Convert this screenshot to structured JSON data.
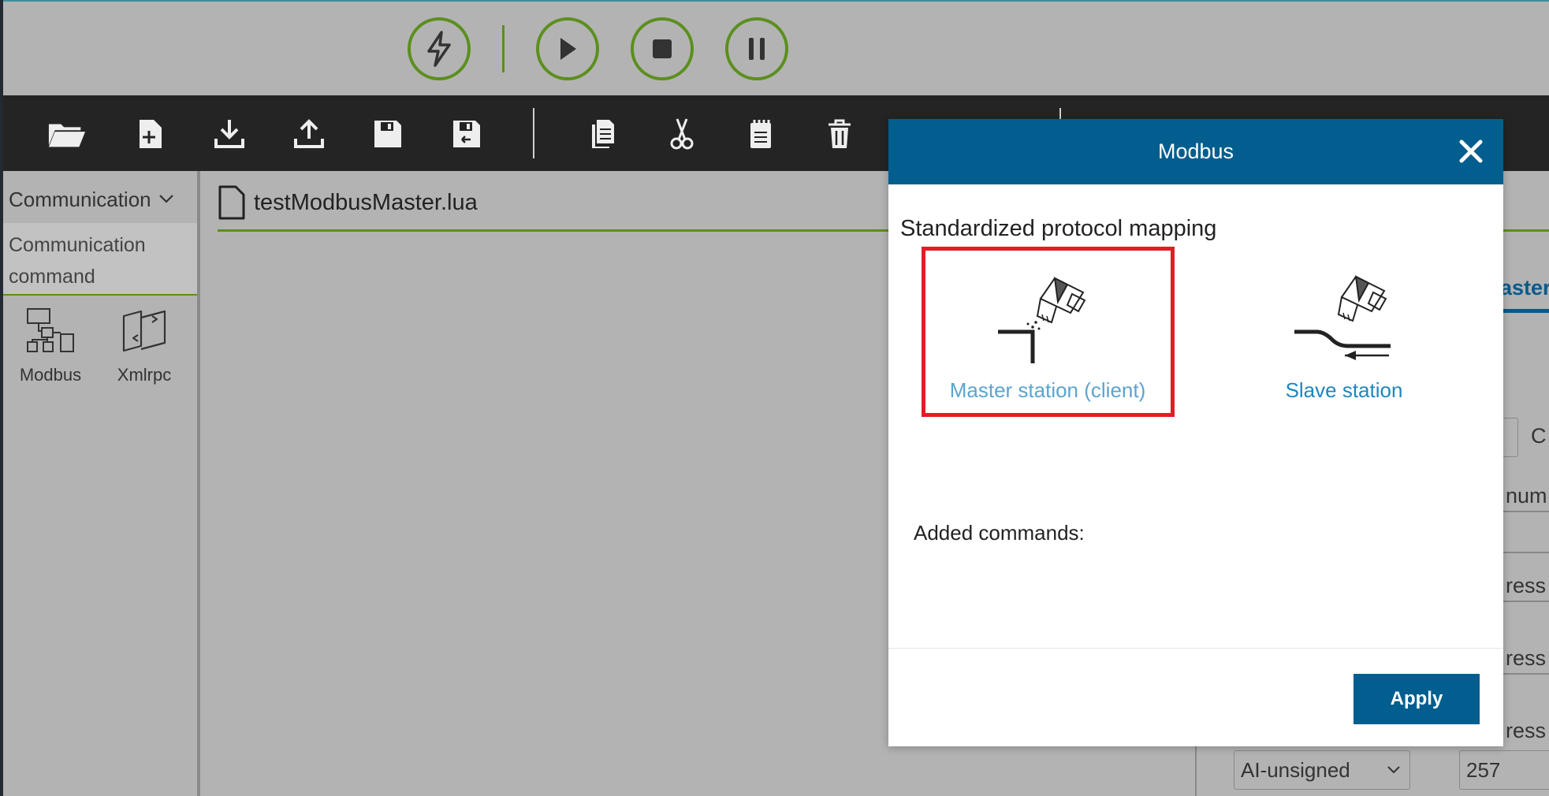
{
  "run_controls": {
    "items": [
      {
        "name": "lightning-icon"
      },
      {
        "name": "play-icon"
      },
      {
        "name": "stop-icon"
      },
      {
        "name": "pause-icon"
      }
    ],
    "accent_color": "#5b8f1e"
  },
  "toolbar": {
    "icons": [
      "open-folder-icon",
      "new-file-icon",
      "download-icon",
      "upload-icon",
      "save-icon",
      "save-as-icon",
      "copy-icon",
      "cut-icon",
      "paste-icon",
      "delete-icon"
    ]
  },
  "sidebar": {
    "category_select": "Communication",
    "category_item": "Communication command",
    "tools": [
      {
        "label": "Modbus",
        "icon": "flowchart-icon"
      },
      {
        "label": "Xmlrpc",
        "icon": "xmlrpc-icon"
      }
    ]
  },
  "editor": {
    "file_name": "testModbusMaster.lua",
    "background_panel": {
      "tab_fragment": "aster",
      "c_fragment": "C",
      "num_fragment": "num",
      "ress_fragments": [
        "ress r",
        "ress r",
        "ress r"
      ],
      "select_value": "AI-unsigned",
      "number_value": "257"
    }
  },
  "modal": {
    "title": "Modbus",
    "section_title": "Standardized protocol mapping",
    "options": [
      {
        "label": "Master station (client)",
        "selected": true
      },
      {
        "label": "Slave station",
        "selected": false
      }
    ],
    "added_commands_label": "Added commands:",
    "apply_label": "Apply",
    "header_color": "#025e8e",
    "highlight_color": "#e21d25"
  }
}
